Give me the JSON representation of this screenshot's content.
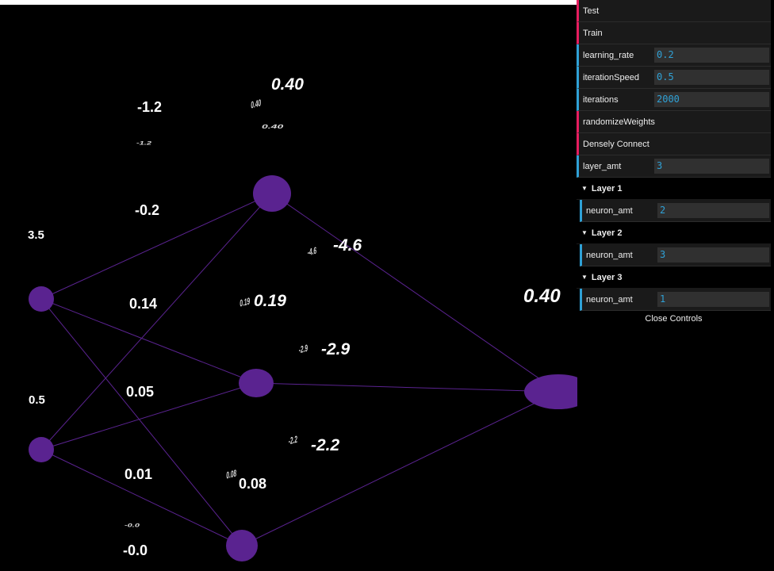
{
  "colors": {
    "background": "#000000",
    "neuron": "#5a2390",
    "edge": "#5a2390",
    "button_accent": "#e61d5f",
    "number_accent": "#2fa1d6"
  },
  "network": {
    "layers": [
      2,
      3,
      1
    ]
  },
  "labels": {
    "output_value": "0.40",
    "input_values": [
      "3.5",
      "0.5"
    ],
    "bias_values": [
      "0.40",
      "0.19",
      "0.08"
    ],
    "weight_values": [
      "-1.2",
      "-0.2",
      "0.14",
      "0.05",
      "0.01",
      "-0.0",
      "-4.6",
      "-2.9",
      "-2.2"
    ],
    "ghosts": {
      "w1": "-1.2",
      "b1": "0.40",
      "w6": "-0.0",
      "b2": "0.19",
      "b3": "0.08",
      "w7": "-4.6",
      "w8": "-2.9",
      "w9": "-2.2"
    }
  },
  "controls": {
    "test_label": "Test",
    "train_label": "Train",
    "learning_rate": {
      "label": "learning_rate",
      "value": "0.2"
    },
    "iteration_speed": {
      "label": "iterationSpeed",
      "value": "0.5"
    },
    "iterations": {
      "label": "iterations",
      "value": "2000"
    },
    "randomize_label": "randomizeWeights",
    "densely_label": "Densely Connect",
    "layer_amt": {
      "label": "layer_amt",
      "value": "3"
    },
    "folders": [
      {
        "title": "Layer 1",
        "field_label": "neuron_amt",
        "value": "2"
      },
      {
        "title": "Layer 2",
        "field_label": "neuron_amt",
        "value": "3"
      },
      {
        "title": "Layer 3",
        "field_label": "neuron_amt",
        "value": "1"
      }
    ],
    "close_label": "Close Controls"
  }
}
